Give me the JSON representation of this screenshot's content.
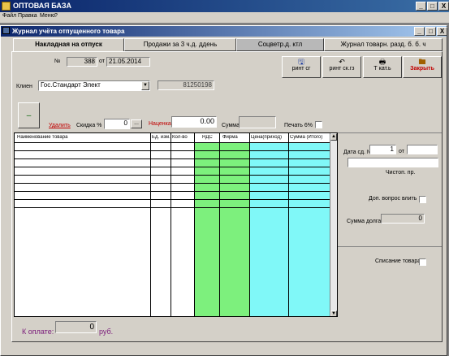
{
  "app": {
    "title": "ОПТОВАЯ БАЗА",
    "win_min": "_",
    "win_max": "□",
    "win_close": "X"
  },
  "menu": [
    "Файл",
    "Правка",
    "Меню",
    "?"
  ],
  "child": {
    "title": "Журнал учёта отпущенного товара",
    "win_min": "_",
    "win_max": "□",
    "win_close": "X"
  },
  "tabs": [
    {
      "label": "Накладная на отпуск"
    },
    {
      "label": "Продажи за 3 ч.д. ддень"
    },
    {
      "label": "Соцветр.д. ктл"
    },
    {
      "label": "Журнал товарн.  разд. б. б. ч"
    }
  ],
  "doc": {
    "number_label": "№",
    "number": "388",
    "date_label": "от",
    "date": "21.05.2014"
  },
  "buttons": {
    "b1": {
      "label": "ринт сг",
      "icon": "🖫"
    },
    "b2": {
      "label": "ринт ск.гз",
      "icon": "↶"
    },
    "b3": {
      "label": "Т кат.ь",
      "icon": "🖶"
    },
    "b4": {
      "label": "Закрыть",
      "icon": "🖿"
    }
  },
  "client": {
    "label": "Клиен",
    "value": "Гос.Стандарт Элект",
    "code": "81250198"
  },
  "discount": {
    "delete_label": "Удалить",
    "label": "Скидка %",
    "value": "0",
    "browse": "...",
    "price_label": "Наценка",
    "price_value": "0.00",
    "sum_label": "Сумма",
    "print_label": "Печать 6%"
  },
  "table": {
    "headers": [
      "Наименование товара",
      "Ед. изм.",
      "Кол-во",
      "НДС",
      "Фирма",
      "Цена(приход)",
      "Сумма (Итого)"
    ]
  },
  "right": {
    "deal_label": "Дата сд. №",
    "deal_num": "1",
    "deal_from": "от",
    "deal_date": "",
    "text_field": "",
    "note_label": "Чистоп. пр.",
    "check1_label": "Доп. вопрос влить",
    "debt_label": "Сумма долга",
    "debt_value": "0",
    "check2_label": "Списание товара"
  },
  "footer": {
    "label": "К оплате:",
    "value": "0",
    "unit": "руб."
  },
  "colors": {
    "green": "#7df07d",
    "cyan": "#80f8f8",
    "title": "#0a246a"
  }
}
